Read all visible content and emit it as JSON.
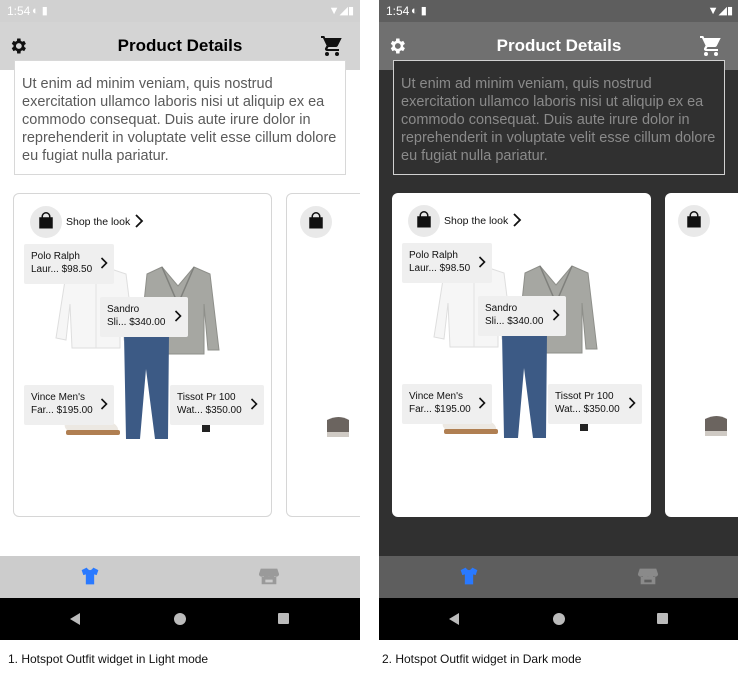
{
  "screens": [
    {
      "status": {
        "time": "1:54"
      },
      "appbar": {
        "title": "Product Details"
      },
      "description": "Ut enim ad minim veniam, quis nostrud exercitation ullamco laboris nisi ut aliquip ex ea commodo consequat. Duis aute irure dolor in reprehenderit in voluptate velit esse cillum dolore eu fugiat nulla pariatur.",
      "shop_label": "Shop the look",
      "hotspots": [
        {
          "name": "Polo Ralph",
          "sub": "Laur...",
          "price": "$98.50"
        },
        {
          "name": "Sandro",
          "sub": "Sli...",
          "price": "$340.00"
        },
        {
          "name": "Vince Men's",
          "sub": "Far...",
          "price": "$195.00"
        },
        {
          "name": "Tissot Pr 100",
          "sub": "Wat...",
          "price": "$350.00"
        }
      ],
      "caption": "1. Hotspot Outfit widget in Light mode"
    },
    {
      "status": {
        "time": "1:54"
      },
      "appbar": {
        "title": "Product Details"
      },
      "description": "Ut enim ad minim veniam, quis nostrud exercitation ullamco laboris nisi ut aliquip ex ea commodo consequat. Duis aute irure dolor in reprehenderit in voluptate velit esse cillum dolore eu fugiat nulla pariatur.",
      "shop_label": "Shop the look",
      "hotspots": [
        {
          "name": "Polo Ralph",
          "sub": "Laur...",
          "price": "$98.50"
        },
        {
          "name": "Sandro",
          "sub": "Sli...",
          "price": "$340.00"
        },
        {
          "name": "Vince Men's",
          "sub": "Far...",
          "price": "$195.00"
        },
        {
          "name": "Tissot Pr 100",
          "sub": "Wat...",
          "price": "$350.00"
        }
      ],
      "caption": "2. Hotspot Outfit widget in Dark mode"
    }
  ],
  "colors": {
    "accent": "#2979ff",
    "light_bar": "#d4d4d4",
    "dark_bar": "#707070",
    "dark_bg": "#303030"
  },
  "icons": [
    "gear-icon",
    "cart-icon",
    "shopping-bag-icon",
    "chevron-right-icon",
    "tshirt-icon",
    "store-icon",
    "back-icon",
    "home-icon",
    "recents-icon"
  ]
}
